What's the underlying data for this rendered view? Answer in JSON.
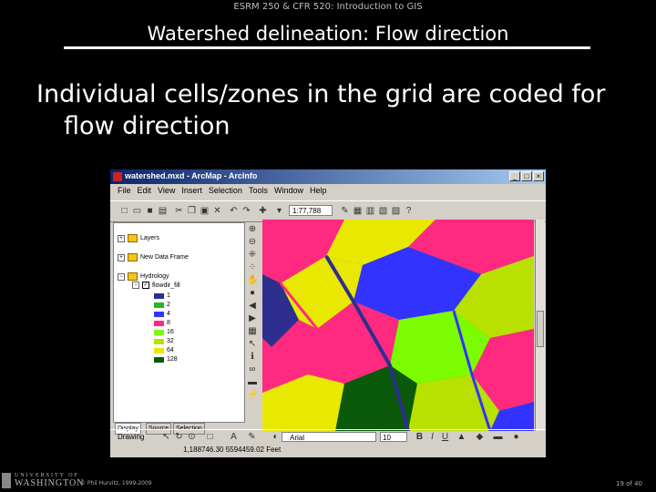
{
  "header": "ESRM 250 & CFR 520: Introduction to GIS",
  "title": "Watershed delineation: Flow direction",
  "bullet": {
    "line1": "Individual cells/zones in the grid are coded for",
    "line2": "flow direction"
  },
  "window": {
    "title": "watershed.mxd - ArcMap - ArcInfo",
    "menus": [
      "File",
      "Edit",
      "View",
      "Insert",
      "Selection",
      "Tools",
      "Window",
      "Help"
    ],
    "scale": "1:77,788",
    "toc": {
      "layer1": "Layers",
      "layer2": "New Data Frame",
      "group": "Hydrology",
      "grid": "flowdir_fill",
      "legend": [
        {
          "label": "1",
          "color": "#2e2e8f"
        },
        {
          "label": "2",
          "color": "#22b822"
        },
        {
          "label": "4",
          "color": "#3333ff"
        },
        {
          "label": "8",
          "color": "#ff2a7f"
        },
        {
          "label": "16",
          "color": "#7cfc00"
        },
        {
          "label": "32",
          "color": "#b8e000"
        },
        {
          "label": "64",
          "color": "#e8e800"
        },
        {
          "label": "128",
          "color": "#0b5a0b"
        }
      ]
    },
    "tabs": [
      "Display",
      "Source",
      "Selection"
    ],
    "drawing": "Drawing",
    "font": "Arial",
    "font_size": "10",
    "coords": "1,188746.30  5594459.02 Feet"
  },
  "footer": {
    "university": "UNIVERSITY OF",
    "washington": "WASHINGTON",
    "copyright": "© Phil Hurvitz, 1999-2009",
    "page": "19 of 40"
  }
}
